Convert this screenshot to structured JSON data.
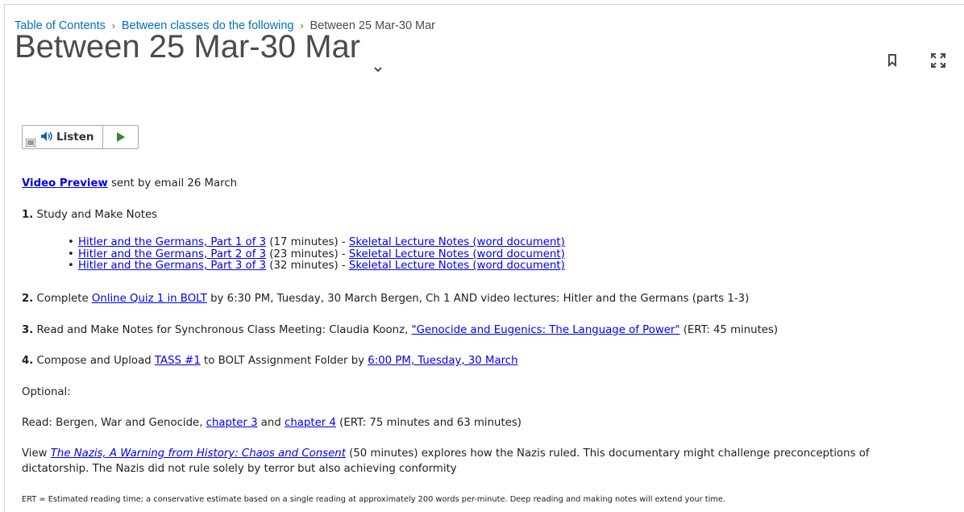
{
  "breadcrumb": {
    "item1": "Table of Contents",
    "item2": "Between classes do the following",
    "current": "Between 25 Mar-30 Mar"
  },
  "title": "Between 25 Mar-30 Mar",
  "listen": {
    "label": "Listen"
  },
  "video_preview": {
    "link": "Video Preview",
    "rest": " sent by email 26 March"
  },
  "step1": {
    "num": "1.",
    "text": " Study and Make Notes",
    "items": [
      {
        "link": "Hitler and the Germans, Part 1 of 3",
        "mins": " (17 minutes) - ",
        "notes": "Skeletal Lecture Notes (word document)"
      },
      {
        "link": "Hitler and the Germans, Part 2 of 3",
        "mins": " (23 minutes) - ",
        "notes": "Skeletal Lecture Notes (word document)"
      },
      {
        "link": "Hitler and the Germans, Part 3 of 3",
        "mins": " (32 minutes) - ",
        "notes": "Skeletal Lecture Notes (word document)"
      }
    ]
  },
  "step2": {
    "num": "2.",
    "pre": " Complete ",
    "link": "Online Quiz 1 in BOLT",
    "post": " by 6:30 PM, Tuesday, 30 March Bergen, Ch 1 AND video lectures: Hitler and the Germans (parts 1-3)"
  },
  "step3": {
    "num": "3.",
    "pre": " Read and Make Notes for Synchronous Class Meeting: Claudia Koonz, ",
    "link": "\"Genocide and Eugenics: The Language of Power\"",
    "post": " (ERT: 45 minutes)"
  },
  "step4": {
    "num": "4.",
    "pre": " Compose and Upload ",
    "link": "TASS #1",
    "mid": " to BOLT Assignment Folder by ",
    "link2": "6:00 PM, Tuesday, 30 March"
  },
  "optional": "Optional:",
  "read": {
    "pre": "Read: Bergen, War and Genocide, ",
    "link1": "chapter 3",
    "and": " and ",
    "link2": "chapter 4",
    "post": " (ERT: 75 minutes and 63 minutes)"
  },
  "view": {
    "pre": "View ",
    "link": "The Nazis, A Warning from History: Chaos and Consent",
    "post": " (50 minutes) explores how the Nazis ruled.  This documentary might challenge preconceptions of",
    "line2": "dictatorship.  The Nazis did not rule solely by terror but also achieving conformity"
  },
  "ert_note": "ERT = Estimated reading time; a conservative estimate based on a single reading at approximately 200 words per-minute. Deep reading and making notes will extend your time.",
  "icons": {
    "bookmark": "bookmark-icon",
    "fullscreen": "fullscreen-icon",
    "menu": "menu-icon",
    "speaker": "speaker-icon",
    "play": "play-icon",
    "chevron": "chevron-down-icon"
  },
  "colors": {
    "link": "#0000ee",
    "breadcrumb_link": "#006fbf",
    "title": "#494c4e",
    "play": "#2e8b2e"
  }
}
